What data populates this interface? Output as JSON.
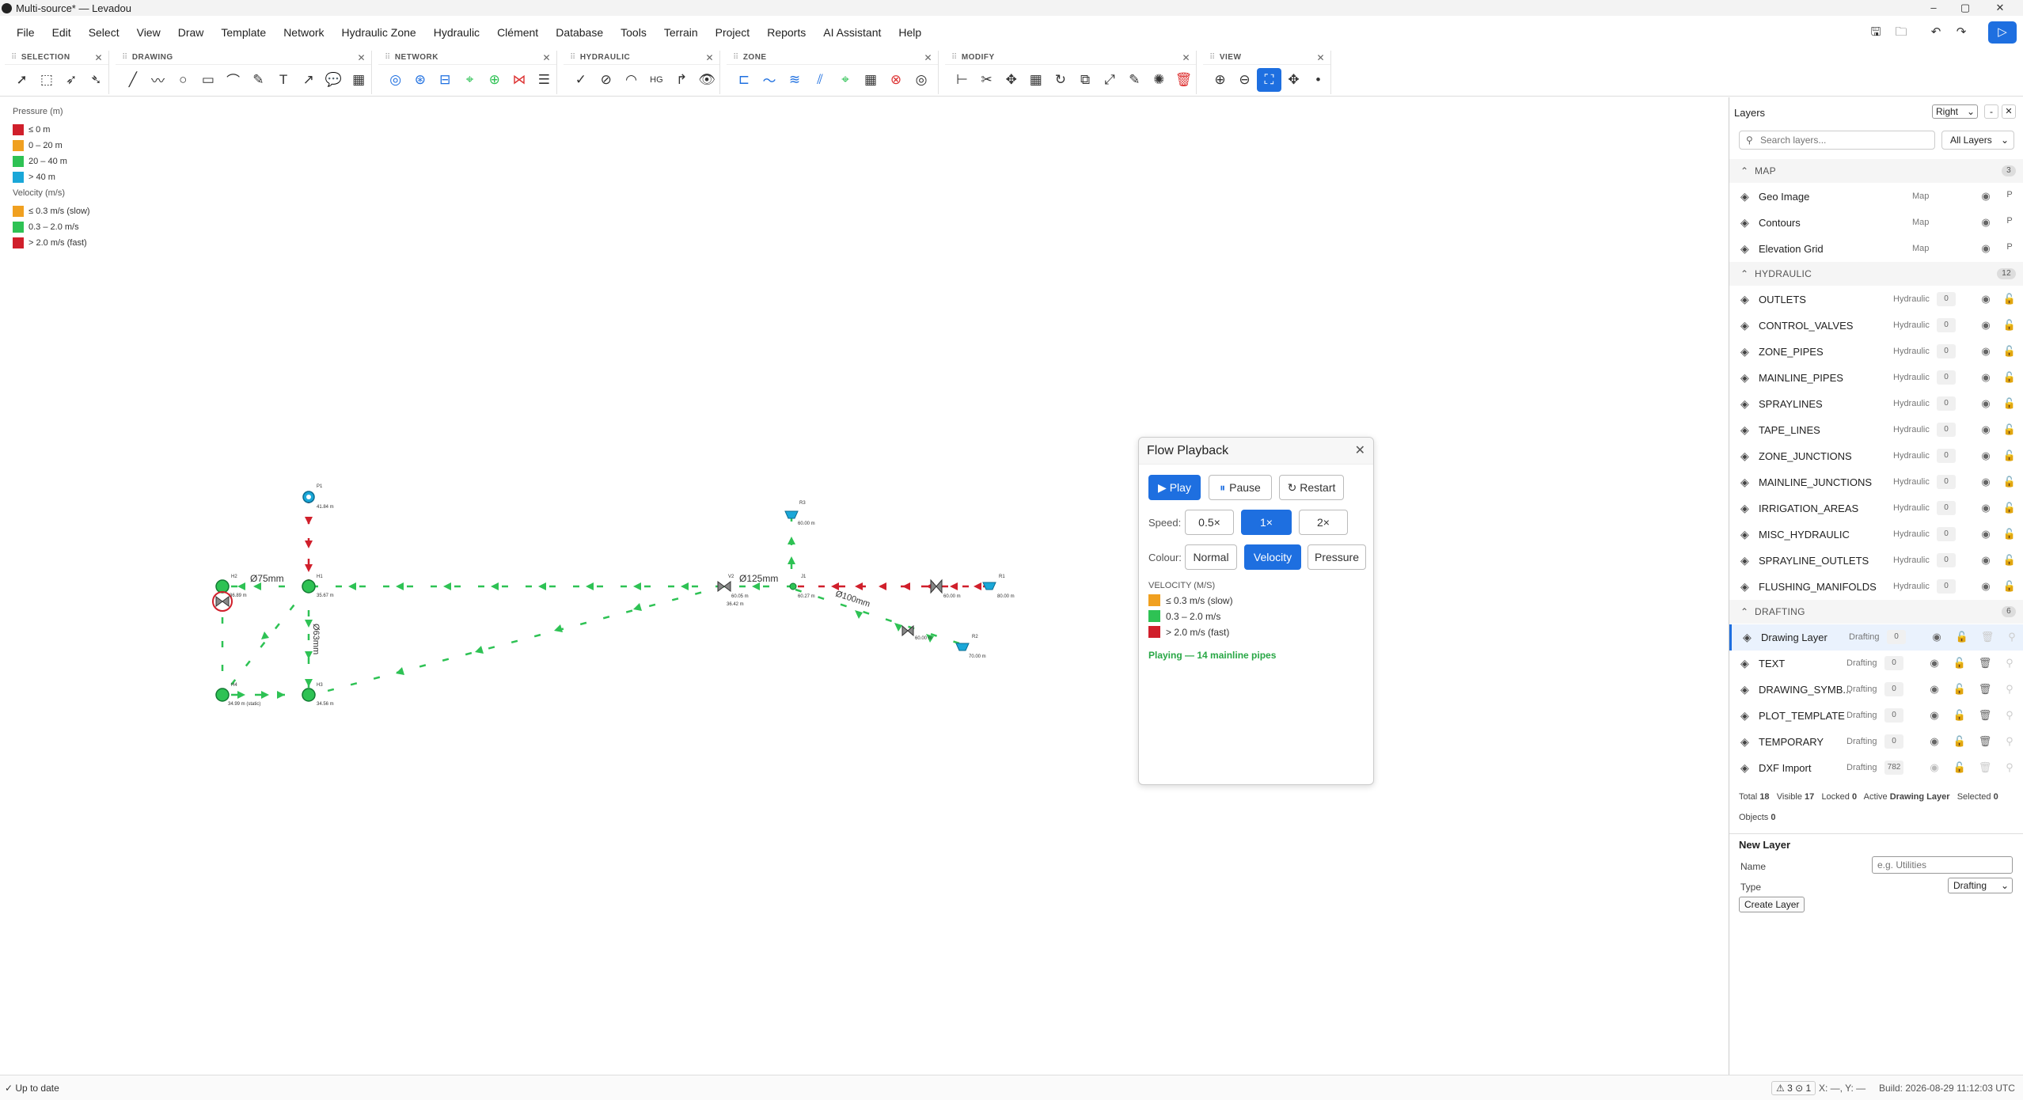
{
  "window": {
    "title": "Multi-source* — Levadou"
  },
  "menu": [
    "File",
    "Edit",
    "Select",
    "View",
    "Draw",
    "Template",
    "Network",
    "Hydraulic Zone",
    "Hydraulic",
    "Clément",
    "Database",
    "Tools",
    "Terrain",
    "Project",
    "Reports",
    "AI Assistant",
    "Help"
  ],
  "toolbar": {
    "groups": [
      "SELECTION",
      "DRAWING",
      "NETWORK",
      "HYDRAULIC",
      "ZONE",
      "MODIFY",
      "VIEW"
    ]
  },
  "legend": {
    "pressure_title": "Pressure (m)",
    "pressure": [
      {
        "label": "≤ 0 m",
        "color": "#d01f2b"
      },
      {
        "label": "0 – 20 m",
        "color": "#f0a020"
      },
      {
        "label": "20 – 40 m",
        "color": "#2ec254"
      },
      {
        "label": "> 40 m",
        "color": "#1aa7d8"
      }
    ],
    "velocity_title": "Velocity (m/s)",
    "velocity": [
      {
        "label": "≤ 0.3 m/s (slow)",
        "color": "#f0a020"
      },
      {
        "label": "0.3 – 2.0 m/s",
        "color": "#2ec254"
      },
      {
        "label": "> 2.0 m/s (fast)",
        "color": "#d01f2b"
      }
    ]
  },
  "network": {
    "pipe_labels": [
      "Ø75mm",
      "Ø63mm",
      "Ø125mm",
      "Ø100mm"
    ],
    "node_labels": {
      "P1": "P1",
      "P1v": "41.84 m",
      "H2": "H2",
      "H2v": "36.89 m",
      "H1": "H1",
      "H1v": "35.67 m",
      "H3": "H3",
      "H3v": "34.56 m",
      "H4": "H4",
      "H4v": "34.99 m (static)",
      "R3": "R3",
      "R3v": "60.00 m",
      "V2": "V2",
      "V2v": "60.05 m",
      "V2b": "36.42 m",
      "J1": "J1",
      "J1v": "60.27 m",
      "V1v": "60.00 m",
      "R1": "R1",
      "R1v": "80.00 m",
      "V3v": "60.00 m",
      "R2": "R2",
      "R2v": "70.00 m"
    }
  },
  "flow": {
    "title": "Flow Playback",
    "play": "▶ Play",
    "pause": "Pause",
    "restart": "↻ Restart",
    "speed_label": "Speed:",
    "speeds": [
      "0.5×",
      "1×",
      "2×"
    ],
    "colour_label": "Colour:",
    "colours": [
      "Normal",
      "Velocity",
      "Pressure"
    ],
    "vel_title": "VELOCITY (M/S)",
    "vel_items": [
      {
        "label": "≤ 0.3 m/s (slow)",
        "color": "#f0a020"
      },
      {
        "label": "0.3 – 2.0 m/s",
        "color": "#2ec254"
      },
      {
        "label": "> 2.0 m/s (fast)",
        "color": "#d01f2b"
      }
    ],
    "status": "Playing — 14 mainline pipes"
  },
  "layers": {
    "title": "Layers",
    "dock": "Right",
    "search_placeholder": "Search layers...",
    "filter": "All Layers",
    "sections": {
      "map": {
        "name": "MAP",
        "count": "3"
      },
      "hydraulic": {
        "name": "HYDRAULIC",
        "count": "12"
      },
      "drafting": {
        "name": "DRAFTING",
        "count": "6"
      }
    },
    "map": [
      {
        "name": "Geo Image",
        "type": "Map"
      },
      {
        "name": "Contours",
        "type": "Map"
      },
      {
        "name": "Elevation Grid",
        "type": "Map"
      }
    ],
    "hydraulic": [
      {
        "name": "OUTLETS",
        "type": "Hydraulic",
        "count": "0"
      },
      {
        "name": "CONTROL_VALVES",
        "type": "Hydraulic",
        "count": "0"
      },
      {
        "name": "ZONE_PIPES",
        "type": "Hydraulic",
        "count": "0"
      },
      {
        "name": "MAINLINE_PIPES",
        "type": "Hydraulic",
        "count": "0"
      },
      {
        "name": "SPRAYLINES",
        "type": "Hydraulic",
        "count": "0"
      },
      {
        "name": "TAPE_LINES",
        "type": "Hydraulic",
        "count": "0"
      },
      {
        "name": "ZONE_JUNCTIONS",
        "type": "Hydraulic",
        "count": "0"
      },
      {
        "name": "MAINLINE_JUNCTIONS",
        "type": "Hydraulic",
        "count": "0"
      },
      {
        "name": "IRRIGATION_AREAS",
        "type": "Hydraulic",
        "count": "0"
      },
      {
        "name": "MISC_HYDRAULIC",
        "type": "Hydraulic",
        "count": "0"
      },
      {
        "name": "SPRAYLINE_OUTLETS",
        "type": "Hydraulic",
        "count": "0"
      },
      {
        "name": "FLUSHING_MANIFOLDS",
        "type": "Hydraulic",
        "count": "0"
      }
    ],
    "drafting": [
      {
        "name": "Drawing Layer",
        "type": "Drafting",
        "count": "0"
      },
      {
        "name": "TEXT",
        "type": "Drafting",
        "count": "0"
      },
      {
        "name": "DRAWING_SYMB...",
        "type": "Drafting",
        "count": "0"
      },
      {
        "name": "PLOT_TEMPLATE",
        "type": "Drafting",
        "count": "0"
      },
      {
        "name": "TEMPORARY",
        "type": "Drafting",
        "count": "0"
      },
      {
        "name": "DXF Import",
        "type": "Drafting",
        "count": "782"
      }
    ],
    "stats": {
      "total_l": "Total",
      "total": "18",
      "visible_l": "Visible",
      "visible": "17",
      "locked_l": "Locked",
      "locked": "0",
      "active_l": "Active",
      "active": "Drawing Layer",
      "selected_l": "Selected",
      "selected": "0",
      "objects_l": "Objects",
      "objects": "0"
    },
    "new_layer": {
      "title": "New Layer",
      "name_label": "Name",
      "name_placeholder": "e.g. Utilities",
      "type_label": "Type",
      "type_value": "Drafting",
      "create": "Create Layer"
    }
  },
  "status": {
    "left": "✓ Up to date",
    "warnings": "⚠ 3 ⊙ 1",
    "coords": "X: —, Y: —",
    "build": "Build: 2026-08-29 11:12:03 UTC"
  }
}
